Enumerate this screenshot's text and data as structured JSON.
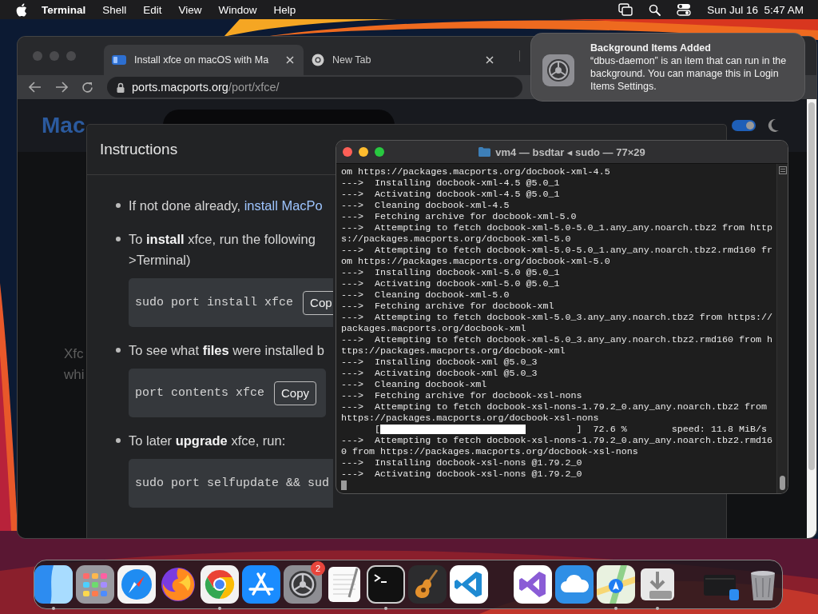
{
  "menu_bar": {
    "app": "Terminal",
    "menus": [
      "Shell",
      "Edit",
      "View",
      "Window",
      "Help"
    ],
    "clock": "Sun Jul 16  5:47 AM"
  },
  "browser": {
    "tabs": [
      {
        "kind": "site",
        "title": "Install xfce on macOS with Ma",
        "selected": true
      },
      {
        "kind": "browser",
        "title": "New Tab",
        "selected": false
      }
    ],
    "url": {
      "host": "ports.macports.org",
      "path": "/port/xfce/"
    },
    "site": {
      "logo": "Mac",
      "behind_text": [
        "Xfc",
        "whi"
      ],
      "theme_toggle": {
        "on": true
      }
    },
    "modal": {
      "title": "Instructions",
      "items": [
        {
          "text": "If not done already, ",
          "link": "install MacPo"
        },
        {
          "text": "To **install** xfce, run the following",
          "continuation": ">Terminal)",
          "code": "sudo port install xfce",
          "copy": "Cop"
        },
        {
          "text": "To see what **files** were installed b",
          "code": "port contents xfce",
          "copy": "Copy"
        },
        {
          "text": "To later **upgrade** xfce, run:",
          "code": "sudo port selfupdate && sud"
        }
      ]
    }
  },
  "terminal": {
    "title": "vm4 — bsdtar ◂ sudo — 77×29",
    "lines": [
      {
        "kind": "text",
        "text": "om https://packages.macports.org/docbook-xml-4.5"
      },
      {
        "kind": "text",
        "text": "--->  Installing docbook-xml-4.5 @5.0_1"
      },
      {
        "kind": "text",
        "text": "--->  Activating docbook-xml-4.5 @5.0_1"
      },
      {
        "kind": "text",
        "text": "--->  Cleaning docbook-xml-4.5"
      },
      {
        "kind": "text",
        "text": "--->  Fetching archive for docbook-xml-5.0"
      },
      {
        "kind": "text",
        "text": "--->  Attempting to fetch docbook-xml-5.0-5.0_1.any_any.noarch.tbz2 from http"
      },
      {
        "kind": "text",
        "text": "s://packages.macports.org/docbook-xml-5.0"
      },
      {
        "kind": "text",
        "text": "--->  Attempting to fetch docbook-xml-5.0-5.0_1.any_any.noarch.tbz2.rmd160 fr"
      },
      {
        "kind": "text",
        "text": "om https://packages.macports.org/docbook-xml-5.0"
      },
      {
        "kind": "text",
        "text": "--->  Installing docbook-xml-5.0 @5.0_1"
      },
      {
        "kind": "text",
        "text": "--->  Activating docbook-xml-5.0 @5.0_1"
      },
      {
        "kind": "text",
        "text": "--->  Cleaning docbook-xml-5.0"
      },
      {
        "kind": "text",
        "text": "--->  Fetching archive for docbook-xml"
      },
      {
        "kind": "text",
        "text": "--->  Attempting to fetch docbook-xml-5.0_3.any_any.noarch.tbz2 from https://"
      },
      {
        "kind": "text",
        "text": "packages.macports.org/docbook-xml"
      },
      {
        "kind": "text",
        "text": "--->  Attempting to fetch docbook-xml-5.0_3.any_any.noarch.tbz2.rmd160 from h"
      },
      {
        "kind": "text",
        "text": "ttps://packages.macports.org/docbook-xml"
      },
      {
        "kind": "text",
        "text": "--->  Installing docbook-xml @5.0_3"
      },
      {
        "kind": "text",
        "text": "--->  Activating docbook-xml @5.0_3"
      },
      {
        "kind": "text",
        "text": "--->  Cleaning docbook-xml"
      },
      {
        "kind": "text",
        "text": "--->  Fetching archive for docbook-xsl-nons"
      },
      {
        "kind": "text",
        "text": "--->  Attempting to fetch docbook-xsl-nons-1.79.2_0.any_any.noarch.tbz2 from"
      },
      {
        "kind": "text",
        "text": "https://packages.macports.org/docbook-xsl-nons"
      },
      {
        "kind": "progress",
        "open": "[",
        "close": "]",
        "level": 0.74,
        "percent": "72.6 %",
        "speed": "speed: 11.8 MiB/s"
      },
      {
        "kind": "text",
        "text": "--->  Attempting to fetch docbook-xsl-nons-1.79.2_0.any_any.noarch.tbz2.rmd16"
      },
      {
        "kind": "text",
        "text": "0 from https://packages.macports.org/docbook-xsl-nons"
      },
      {
        "kind": "text",
        "text": "--->  Installing docbook-xsl-nons @1.79.2_0"
      },
      {
        "kind": "text",
        "text": "--->  Activating docbook-xsl-nons @1.79.2_0"
      },
      {
        "kind": "cursor"
      }
    ]
  },
  "notification": {
    "title": "Background Items Added",
    "body": "“dbus-daemon” is an item that can run in the background. You can manage this in Login Items Settings."
  },
  "dock": {
    "sections": [
      [
        {
          "kind": "finder",
          "running": true
        },
        {
          "kind": "launchpad",
          "running": false
        },
        {
          "kind": "safari",
          "running": false
        },
        {
          "kind": "firefox",
          "running": false
        },
        {
          "kind": "chrome",
          "running": true
        },
        {
          "kind": "appstore",
          "running": false
        },
        {
          "kind": "settings",
          "running": false,
          "badge": "2"
        },
        {
          "kind": "textedit",
          "running": false
        },
        {
          "kind": "terminal",
          "running": true
        },
        {
          "kind": "garageband",
          "running": false
        },
        {
          "kind": "vscode",
          "running": false
        }
      ],
      [
        {
          "kind": "visualstudio",
          "running": false
        },
        {
          "kind": "weather",
          "running": false
        },
        {
          "kind": "maps",
          "running": true
        },
        {
          "kind": "installer",
          "running": true
        }
      ],
      [
        {
          "kind": "minimized",
          "running": false
        },
        {
          "kind": "trash",
          "running": false
        }
      ]
    ]
  }
}
